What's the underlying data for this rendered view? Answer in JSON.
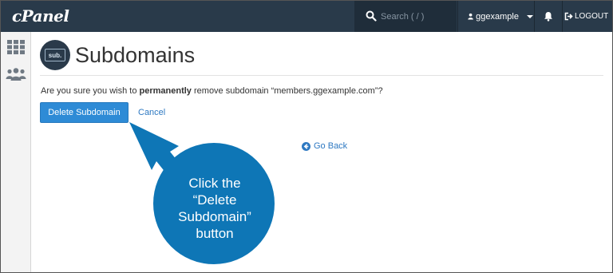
{
  "header": {
    "logo": "cPanel",
    "search_placeholder": "Search ( / )",
    "username": "ggexample",
    "logout_label": "LOGOUT"
  },
  "sidebar": {
    "items": [
      {
        "icon": "grid-icon"
      },
      {
        "icon": "users-icon"
      }
    ]
  },
  "page": {
    "badge_text": "sub.",
    "title": "Subdomains",
    "confirm_prefix": "Are you sure you wish to ",
    "confirm_emphasis": "permanently",
    "confirm_suffix": " remove subdomain “members.ggexample.com”?",
    "delete_button": "Delete Subdomain",
    "cancel_link": "Cancel",
    "go_back": "Go Back"
  },
  "callout": {
    "lines": [
      "Click the",
      "“Delete",
      "Subdomain”",
      "button"
    ],
    "color": "#0e76b6"
  },
  "colors": {
    "topbar": "#293a4a",
    "primary_button": "#2e8bd6",
    "link": "#2e79c2"
  }
}
